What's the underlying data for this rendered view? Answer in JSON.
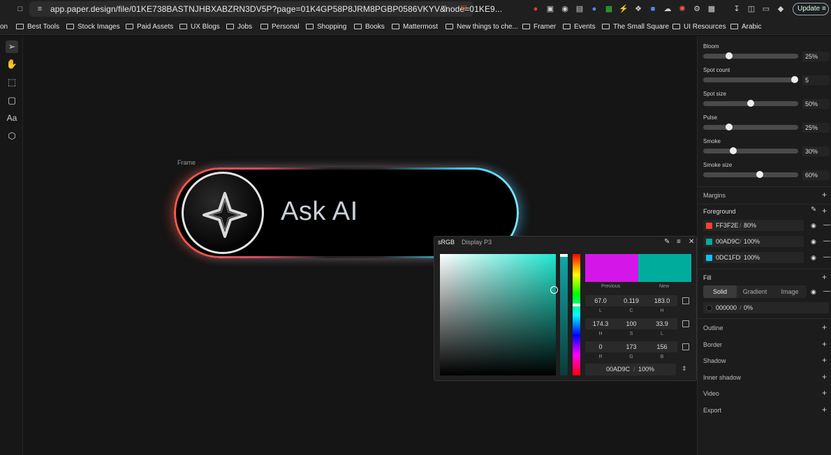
{
  "browser": {
    "url": "app.paper.design/file/01KE738BASTNJHBXABZRN3DV5P?page=01K4GP58P8JRM8PGBP0586VKYV&node=01KE9...",
    "update_label": "Update"
  },
  "bookmarks": [
    {
      "label": "on"
    },
    {
      "label": "Best Tools"
    },
    {
      "label": "Stock Images"
    },
    {
      "label": "Paid Assets"
    },
    {
      "label": "UX Blogs"
    },
    {
      "label": "Jobs"
    },
    {
      "label": "Personal"
    },
    {
      "label": "Shopping"
    },
    {
      "label": "Books"
    },
    {
      "label": "Mattermost"
    },
    {
      "label": "New things to che..."
    },
    {
      "label": "Framer"
    },
    {
      "label": "Events"
    },
    {
      "label": "The Small Square"
    },
    {
      "label": "UI Resources"
    },
    {
      "label": "Arabic"
    }
  ],
  "tools": {
    "text_tool_label": "Aa"
  },
  "canvas": {
    "frame_label": "Frame",
    "button_text": "Ask AI"
  },
  "picker": {
    "tab_srgb": "sRGB",
    "tab_p3": "Display P3",
    "previous_label": "Previous",
    "new_label": "New",
    "previous_color": "#d417e8",
    "new_color": "#00ad9c",
    "lch": {
      "l": "67.0",
      "c": "0.119",
      "h": "183.0",
      "l_lab": "L",
      "c_lab": "C",
      "h_lab": "H"
    },
    "hsl": {
      "h": "174.3",
      "s": "100",
      "l": "33.9",
      "h_lab": "H",
      "s_lab": "S",
      "l_lab": "L"
    },
    "rgb": {
      "r": "0",
      "g": "173",
      "b": "156",
      "r_lab": "R",
      "g_lab": "G",
      "b_lab": "B"
    },
    "hex": "00AD9C",
    "sep": "/",
    "alpha": "100%"
  },
  "panel": {
    "sliders": [
      {
        "label": "Bloom",
        "value": "25%",
        "fraction": 0.25
      },
      {
        "label": "Spot count",
        "value": "5",
        "fraction": 1.0
      },
      {
        "label": "Spot size",
        "value": "50%",
        "fraction": 0.5
      },
      {
        "label": "Pulse",
        "value": "25%",
        "fraction": 0.25
      },
      {
        "label": "Smoke",
        "value": "30%",
        "fraction": 0.3
      },
      {
        "label": "Smoke size",
        "value": "60%",
        "fraction": 0.6
      }
    ],
    "margins": "Margins",
    "foreground": "Foreground",
    "fg_colors": [
      {
        "hex": "FF3F2E",
        "sep": "/",
        "alpha": "80%",
        "color": "#ff3f2e"
      },
      {
        "hex": "00AD9C",
        "sep": "/",
        "alpha": "100%",
        "color": "#00ad9c"
      },
      {
        "hex": "0DC1FD",
        "sep": "/",
        "alpha": "100%",
        "color": "#0dc1fd"
      }
    ],
    "fill": "Fill",
    "fill_tabs": {
      "solid": "Solid",
      "gradient": "Gradient",
      "image": "Image"
    },
    "fill_value": {
      "hex": "000000",
      "sep": "/",
      "alpha": "0%"
    },
    "sections": [
      "Outline",
      "Border",
      "Shadow",
      "Inner shadow",
      "Video",
      "Export"
    ]
  }
}
